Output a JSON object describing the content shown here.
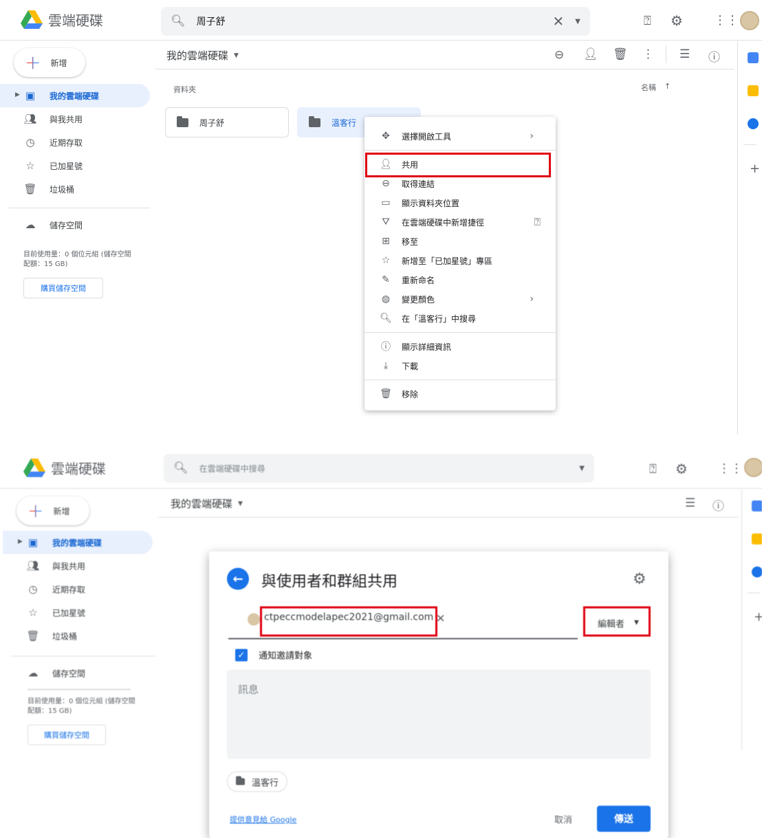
{
  "app": {
    "title": "雲端硬碟"
  },
  "colors": {
    "accent": "#1a73e8",
    "highlight": "#e00010",
    "active_bg": "#e8f0fe"
  },
  "shot1": {
    "search_value": "周子舒",
    "nav": {
      "new_label": "新增",
      "items": [
        {
          "label": "我的雲端硬碟",
          "icon": "my-drive-icon"
        },
        {
          "label": "與我共用",
          "icon": "shared-icon"
        },
        {
          "label": "近期存取",
          "icon": "clock-icon"
        },
        {
          "label": "已加星號",
          "icon": "star-icon"
        },
        {
          "label": "垃圾桶",
          "icon": "trash-icon"
        }
      ],
      "storage_label": "儲存空間",
      "usage_text": "目前使用量：0 個位元組 (儲存空間配額：15 GB)",
      "buy_storage": "購買儲存空間"
    },
    "breadcrumb": "我的雲端硬碟",
    "section_label": "資料夾",
    "sort_label": "名稱",
    "folders": [
      "周子舒",
      "溫客行"
    ],
    "context_menu": [
      {
        "label": "選擇開啟工具",
        "icon": "open-with-icon",
        "submenu": true
      },
      {
        "label": "共用",
        "icon": "share-person-icon",
        "highlighted": true
      },
      {
        "label": "取得連結",
        "icon": "link-icon"
      },
      {
        "label": "顯示資料夾位置",
        "icon": "folder-outline-icon"
      },
      {
        "label": "在雲端硬碟中新增捷徑",
        "icon": "add-shortcut-icon",
        "help": true
      },
      {
        "label": "移至",
        "icon": "move-icon"
      },
      {
        "label": "新增至「已加星號」專區",
        "icon": "star-icon"
      },
      {
        "label": "重新命名",
        "icon": "pencil-icon"
      },
      {
        "label": "變更顏色",
        "icon": "palette-icon",
        "submenu": true
      },
      {
        "label": "在「溫客行」中搜尋",
        "icon": "search-icon"
      },
      {
        "label": "顯示詳細資訊",
        "icon": "info-icon"
      },
      {
        "label": "下載",
        "icon": "download-icon"
      },
      {
        "label": "移除",
        "icon": "trash-icon"
      }
    ]
  },
  "shot2": {
    "search_placeholder": "在雲端硬碟中搜尋",
    "nav": {
      "new_label": "新增",
      "items": [
        {
          "label": "我的雲端硬碟",
          "icon": "my-drive-icon"
        },
        {
          "label": "與我共用",
          "icon": "shared-icon"
        },
        {
          "label": "近期存取",
          "icon": "clock-icon"
        },
        {
          "label": "已加星號",
          "icon": "star-icon"
        },
        {
          "label": "垃圾桶",
          "icon": "trash-icon"
        }
      ],
      "storage_label": "儲存空間",
      "usage_text": "目前使用量：0 個位元組 (儲存空間配額：15 GB)",
      "buy_storage": "購買儲存空間"
    },
    "breadcrumb": "我的雲端硬碟",
    "dialog": {
      "title": "與使用者和群組共用",
      "recipient_email": "ctpeccmodelapec2021@gmail.com",
      "role": "編輯者",
      "notify_label": "通知邀請對象",
      "notify_checked": true,
      "message_placeholder": "訊息",
      "folder_chip": "溫客行",
      "feedback_link": "提供意見給 Google",
      "cancel": "取消",
      "send": "傳送"
    }
  }
}
